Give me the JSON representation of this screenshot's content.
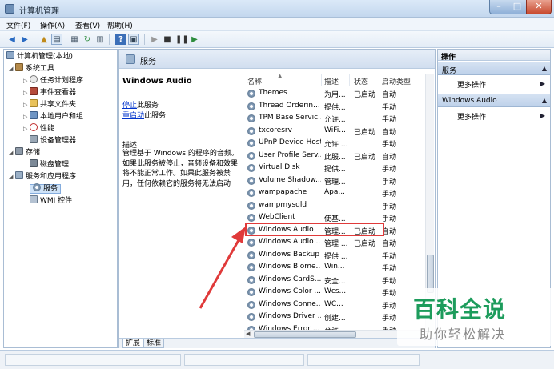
{
  "window": {
    "title": "计算机管理"
  },
  "menu": [
    "文件(F)",
    "操作(A)",
    "查看(V)",
    "帮助(H)"
  ],
  "toolbar": {
    "icons": [
      "back-arrow-icon",
      "forward-arrow-icon",
      "up-folder-icon",
      "show-hide-tree-icon",
      "properties-icon",
      "refresh-icon",
      "export-list-icon",
      "help-icon",
      "show-hide-action-pane-icon",
      "start-service-icon",
      "stop-service-icon",
      "pause-service-icon",
      "restart-service-icon"
    ]
  },
  "tree": [
    {
      "label": "计算机管理(本地)",
      "icon": "computer-icon",
      "twisty": ""
    },
    {
      "label": "系统工具",
      "icon": "tools-icon",
      "twisty": "◢"
    },
    {
      "label": "任务计划程序",
      "icon": "clock-icon",
      "twisty": "▷"
    },
    {
      "label": "事件查看器",
      "icon": "event-viewer-icon",
      "twisty": "▷"
    },
    {
      "label": "共享文件夹",
      "icon": "folder-icon",
      "twisty": "▷"
    },
    {
      "label": "本地用户和组",
      "icon": "users-icon",
      "twisty": "▷"
    },
    {
      "label": "性能",
      "icon": "performance-icon",
      "twisty": "▷"
    },
    {
      "label": "设备管理器",
      "icon": "device-manager-icon",
      "twisty": ""
    },
    {
      "label": "存储",
      "icon": "storage-icon",
      "twisty": "◢"
    },
    {
      "label": "磁盘管理",
      "icon": "disk-icon",
      "twisty": ""
    },
    {
      "label": "服务和应用程序",
      "icon": "services-apps-icon",
      "twisty": "◢"
    },
    {
      "label": "服务",
      "icon": "gear-icon",
      "twisty": "",
      "selected": true
    },
    {
      "label": "WMI 控件",
      "icon": "wmi-icon",
      "twisty": ""
    }
  ],
  "center": {
    "header": "服务",
    "selected_title": "Windows Audio",
    "stop_link": "停止",
    "stop_suffix": "此服务",
    "restart_link": "重启动",
    "restart_suffix": "此服务",
    "description_label": "描述:",
    "description": "管理基于 Windows 的程序的音频。如果此服务被停止，音频设备和效果将不能正常工作。如果此服务被禁用，任何依赖它的服务将无法启动",
    "columns": [
      "名称",
      "描述",
      "状态",
      "启动类型"
    ],
    "sort_arrow": "▲",
    "rows": [
      {
        "name": "Themes",
        "desc": "为用...",
        "status": "已启动",
        "startup": "自动"
      },
      {
        "name": "Thread Orderin...",
        "desc": "提供...",
        "status": "",
        "startup": "手动"
      },
      {
        "name": "TPM Base Servic...",
        "desc": "允许...",
        "status": "",
        "startup": "手动"
      },
      {
        "name": "txcoresrv",
        "desc": "WiFi...",
        "status": "已启动",
        "startup": "自动"
      },
      {
        "name": "UPnP Device Host",
        "desc": "允许 ...",
        "status": "",
        "startup": "手动"
      },
      {
        "name": "User Profile Serv...",
        "desc": "此服...",
        "status": "已启动",
        "startup": "自动"
      },
      {
        "name": "Virtual Disk",
        "desc": "提供...",
        "status": "",
        "startup": "手动"
      },
      {
        "name": "Volume Shadow...",
        "desc": "管理...",
        "status": "",
        "startup": "手动"
      },
      {
        "name": "wampapache",
        "desc": "Apa...",
        "status": "",
        "startup": "手动"
      },
      {
        "name": "wampmysqld",
        "desc": "",
        "status": "",
        "startup": "手动"
      },
      {
        "name": "WebClient",
        "desc": "使基...",
        "status": "",
        "startup": "手动"
      },
      {
        "name": "Windows Audio",
        "desc": "管理...",
        "status": "已启动",
        "startup": "自动"
      },
      {
        "name": "Windows Audio ...",
        "desc": "管理 ...",
        "status": "已启动",
        "startup": "自动"
      },
      {
        "name": "Windows Backup",
        "desc": "提供 ...",
        "status": "",
        "startup": "手动"
      },
      {
        "name": "Windows Biome...",
        "desc": "Win...",
        "status": "",
        "startup": "手动"
      },
      {
        "name": "Windows CardS...",
        "desc": "安全...",
        "status": "",
        "startup": "手动"
      },
      {
        "name": "Windows Color ...",
        "desc": "Wcs...",
        "status": "",
        "startup": "手动"
      },
      {
        "name": "Windows Conne...",
        "desc": "WC...",
        "status": "",
        "startup": "手动"
      },
      {
        "name": "Windows Driver ...",
        "desc": "创建...",
        "status": "",
        "startup": "手动"
      },
      {
        "name": "Windows Error ...",
        "desc": "允许...",
        "status": "",
        "startup": "手动"
      }
    ],
    "tabs": [
      "扩展",
      "标准"
    ]
  },
  "actions": {
    "title": "操作",
    "sections": [
      {
        "label": "服务",
        "item": "更多操作"
      },
      {
        "label": "Windows Audio",
        "item": "更多操作"
      }
    ]
  },
  "watermark": {
    "logo": "百科全说",
    "sub": "助你轻松解决"
  },
  "colors": {
    "highlight": "#e03a3a",
    "arrow": "#e03a3a",
    "watermark_green": "#1d9c5c"
  }
}
